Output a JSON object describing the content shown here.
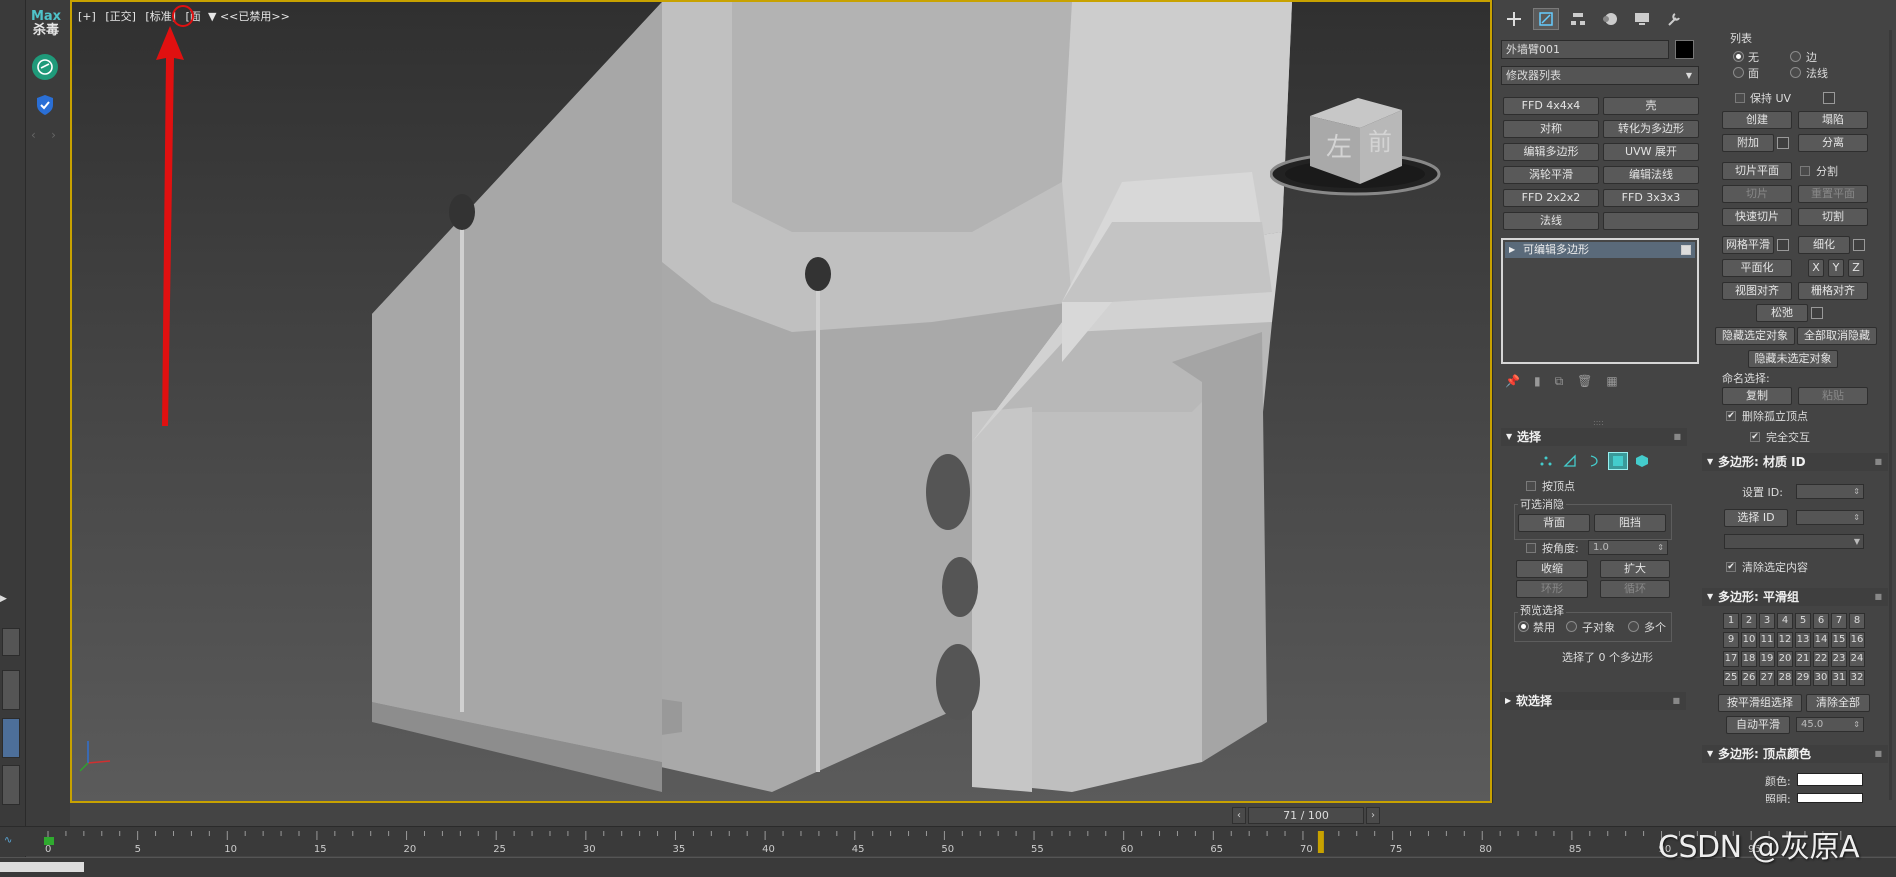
{
  "app": {
    "logo_top": "Max",
    "logo_bottom": "杀毒",
    "nav_prev": "‹",
    "nav_next": "›"
  },
  "viewport": {
    "labels": [
      "[+]",
      "[正交]",
      "[标准]",
      "[面"
    ],
    "filter_text": "<<已禁用>>",
    "viewcube_left": "左",
    "viewcube_front": "前",
    "annotation_color": "#e01010",
    "border_color": "#c8a200"
  },
  "time": {
    "readout": "71 / 100",
    "prev": "‹",
    "next": "›",
    "current_frame": 71,
    "ticks": [
      "0",
      "5",
      "10",
      "15",
      "20",
      "25",
      "30",
      "35",
      "40",
      "45",
      "50",
      "55",
      "60",
      "65",
      "70",
      "75",
      "80",
      "85",
      "90",
      "95"
    ],
    "marker_color": "#c8a200"
  },
  "watermark": "CSDN @灰原A",
  "command_panel": {
    "tabs": [
      "create-icon",
      "modify-icon",
      "hierarchy-icon",
      "motion-icon",
      "display-icon",
      "utilities-icon"
    ],
    "object_name": "外墙臂001",
    "modifier_list": "修改器列表",
    "modifier_buttons": [
      "FFD 4x4x4",
      "壳",
      "对称",
      "转化为多边形",
      "编辑多边形",
      "UVW 展开",
      "涡轮平滑",
      "编辑法线",
      "FFD 2x2x2",
      "FFD 3x3x3",
      "法线",
      ""
    ],
    "stack_item": "可编辑多边形",
    "selection": {
      "title": "选择",
      "by_vertex": "按顶点",
      "ignore_back": "可选消隐",
      "back_btn": "背面",
      "occlude_btn": "阻挡",
      "by_angle": "按角度:",
      "angle_value": "1.0",
      "shrink": "收缩",
      "grow": "扩大",
      "ring": "环形",
      "loop": "循环",
      "preview": "预览选择",
      "preview_options": [
        "禁用",
        "子对象",
        "多个"
      ],
      "status": "选择了 0 个多边形"
    },
    "soft_selection": {
      "title": "软选择"
    },
    "right_col": {
      "partial_header": "列表",
      "radio_none": "无",
      "radio_edge": "边",
      "radio_face": "面",
      "radio_normal": "法线",
      "keep_uv": "保持 UV",
      "create": "创建",
      "collapse": "塌陷",
      "attach": "附加",
      "detach": "分离",
      "slice_plane": "切片平面",
      "split": "分割",
      "slice": "切片",
      "reset_plane": "重置平面",
      "quick_slice": "快速切片",
      "cut": "切割",
      "meshsmooth": "网格平滑",
      "tessellate": "细化",
      "make_planar": "平面化",
      "x": "X",
      "y": "Y",
      "z": "Z",
      "view_align": "视图对齐",
      "grid_align": "栅格对齐",
      "relax": "松弛",
      "hide_selected": "隐藏选定对象",
      "unhide_all": "全部取消隐藏",
      "hide_unselected": "隐藏未选定对象",
      "named_sel": "命名选择:",
      "copy": "复制",
      "paste": "粘贴",
      "delete_iso": "删除孤立顶点",
      "full_interact": "完全交互"
    },
    "material_ids": {
      "title": "多边形: 材质 ID",
      "set_id": "设置 ID:",
      "select_id": "选择 ID",
      "clear_sel": "清除选定内容"
    },
    "smoothing": {
      "title": "多边形: 平滑组",
      "groups": [
        "1",
        "2",
        "3",
        "4",
        "5",
        "6",
        "7",
        "8",
        "9",
        "10",
        "11",
        "12",
        "13",
        "14",
        "15",
        "16",
        "17",
        "18",
        "19",
        "20",
        "21",
        "22",
        "23",
        "24",
        "25",
        "26",
        "27",
        "28",
        "29",
        "30",
        "31",
        "32"
      ],
      "select_by_sg": "按平滑组选择",
      "clear_all": "清除全部",
      "auto_smooth": "自动平滑",
      "auto_value": "45.0"
    },
    "vertex_colors": {
      "title": "多边形: 顶点颜色",
      "color": "颜色:",
      "illum": "照明:"
    }
  }
}
